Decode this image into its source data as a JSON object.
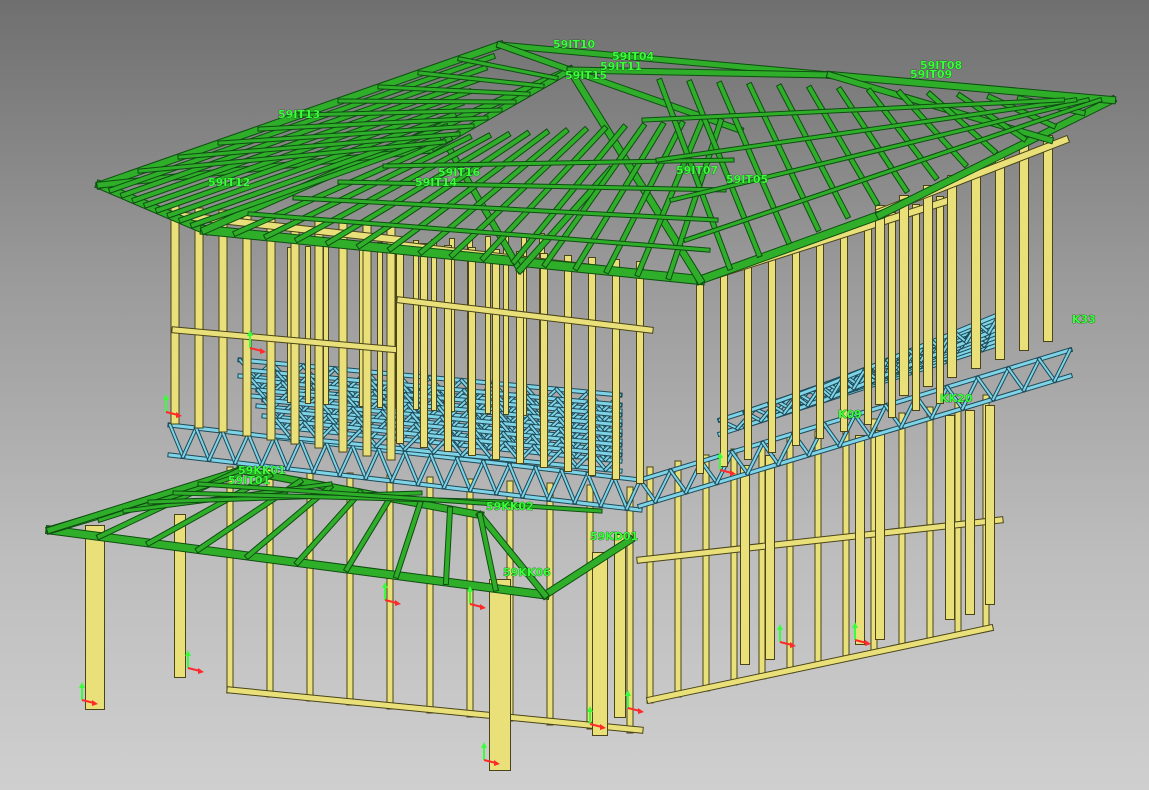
{
  "viewer": {
    "background_top": "#6f6f6f",
    "background_bottom": "#cfcfcf"
  },
  "colors": {
    "roof_members": "#2fae2a",
    "roof_members_dark": "#0f4d12",
    "wall_studs": "#e9e07a",
    "wall_studs_dark": "#4a4418",
    "floor_joists": "#7fd3e6",
    "floor_joists_dark": "#1d4a58",
    "labels": "#39ff3a",
    "axis_x": "#ff2a2a",
    "axis_y": "#39ff3a"
  },
  "labels": {
    "t10": "59IT10",
    "t04": "59IT04",
    "t11": "59IT11",
    "t15": "59IT15",
    "t08": "59IT08",
    "t09": "59IT09",
    "t13": "59IT13",
    "t16": "59IT16",
    "t14": "59IT14",
    "t07": "59IT07",
    "t05": "59IT05",
    "t12": "59IT12",
    "kk01": "59KK01",
    "t01": "59IT01",
    "k02": "59KK02",
    "k33": "K33",
    "k20": "KK20",
    "k09": "K09",
    "d01": "59KD01",
    "k06": "59KK06"
  }
}
